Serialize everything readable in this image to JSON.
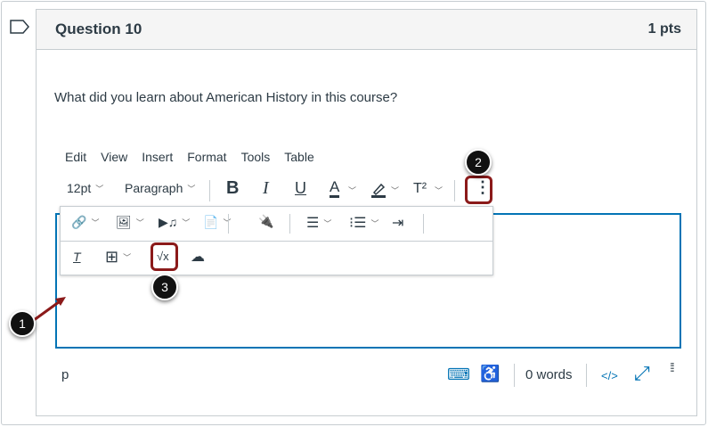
{
  "question": {
    "title": "Question 10",
    "points": "1 pts",
    "text": "What did you learn about American History in this course?"
  },
  "menu": [
    "Edit",
    "View",
    "Insert",
    "Format",
    "Tools",
    "Table"
  ],
  "toolbar": {
    "font_size": "12pt",
    "block": "Paragraph",
    "bold": "B",
    "italic": "I",
    "underline": "U",
    "text_color": "A",
    "superscript": "T²",
    "more": "⋮"
  },
  "float_toolbar": {
    "math": "√x"
  },
  "status": {
    "path": "p",
    "word_count": "0 words",
    "html": "</>"
  },
  "callouts": [
    "1",
    "2",
    "3"
  ],
  "colors": {
    "accent": "#0374B5",
    "highlight": "#8b1a1a"
  }
}
